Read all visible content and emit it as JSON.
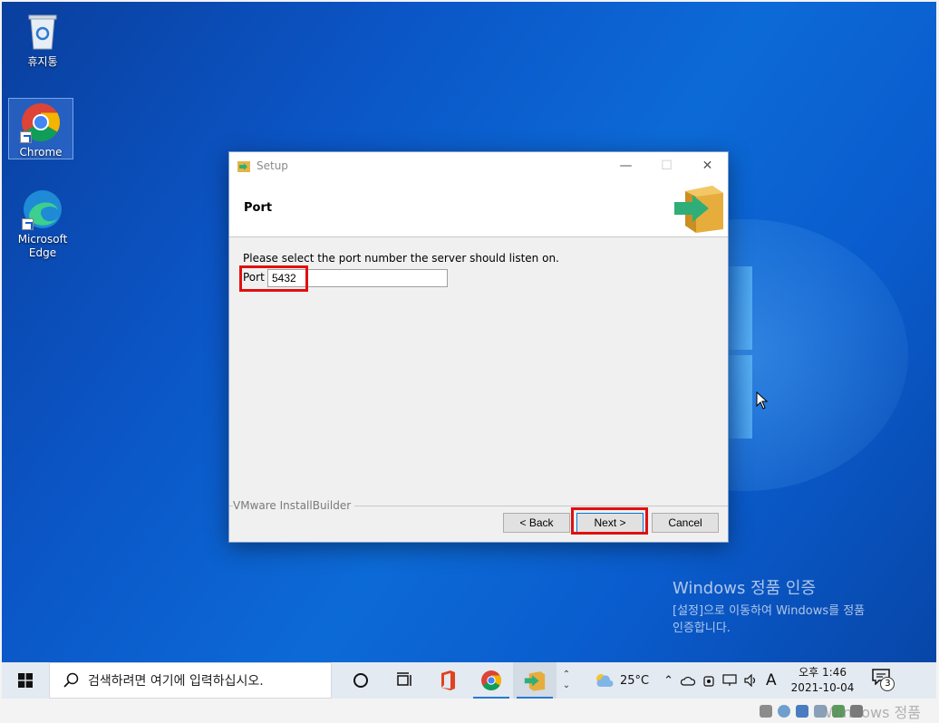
{
  "desktop": {
    "icons": [
      {
        "label": "휴지통"
      },
      {
        "label": "Chrome"
      },
      {
        "label": "Microsoft Edge"
      }
    ],
    "activation": {
      "title": "Windows 정품 인증",
      "line1": "[설정]으로 이동하여 Windows를 정품",
      "line2": "인증합니다."
    }
  },
  "setup": {
    "window_title": "Setup",
    "page_title": "Port",
    "prompt": "Please select the port number the server should listen on.",
    "port_label": "Port",
    "port_value": "5432",
    "brand": "VMware InstallBuilder",
    "buttons": {
      "back": "< Back",
      "next": "Next >",
      "cancel": "Cancel"
    },
    "window_controls": {
      "minimize": "—",
      "maximize": "☐",
      "close": "✕"
    }
  },
  "taskbar": {
    "search_placeholder": "검색하려면 여기에 입력하십시오.",
    "weather": "25°C",
    "ime": "A",
    "time": "오후 1:46",
    "date": "2021-10-04",
    "notification_count": "3"
  },
  "vm_status": {
    "ghost_text": "Windows 정품"
  },
  "colors": {
    "highlight": "#e01010",
    "desktop_blue": "#0b56c7"
  }
}
